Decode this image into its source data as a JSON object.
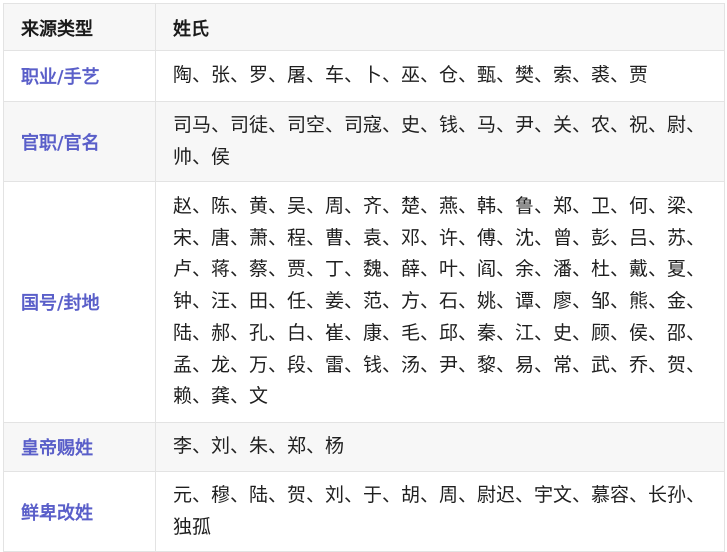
{
  "table": {
    "headers": [
      "来源类型",
      "姓氏"
    ],
    "rows": [
      {
        "type": "职业/手艺",
        "names": "陶、张、罗、屠、车、卜、巫、仓、甄、樊、索、裘、贾"
      },
      {
        "type": "官职/官名",
        "names": "司马、司徒、司空、司寇、史、钱、马、尹、关、农、祝、尉、帅、侯"
      },
      {
        "type": "国号/封地",
        "names": "赵、陈、黄、吴、周、齐、楚、燕、韩、鲁、郑、卫、何、梁、宋、唐、萧、程、曹、袁、邓、许、傅、沈、曾、彭、吕、苏、卢、蒋、蔡、贾、丁、魏、薛、叶、阎、余、潘、杜、戴、夏、钟、汪、田、任、姜、范、方、石、姚、谭、廖、邹、熊、金、陆、郝、孔、白、崔、康、毛、邱、秦、江、史、顾、侯、邵、孟、龙、万、段、雷、钱、汤、尹、黎、易、常、武、乔、贺、赖、龚、文"
      },
      {
        "type": "皇帝赐姓",
        "names": "李、刘、朱、郑、杨"
      },
      {
        "type": "鲜卑改姓",
        "names": "元、穆、陆、贺、刘、于、胡、周、尉迟、宇文、慕容、长孙、独孤"
      }
    ]
  },
  "colors": {
    "accent": "#5a5fc9",
    "header_bg": "#f7f7f7",
    "border": "#e3e3e3"
  }
}
